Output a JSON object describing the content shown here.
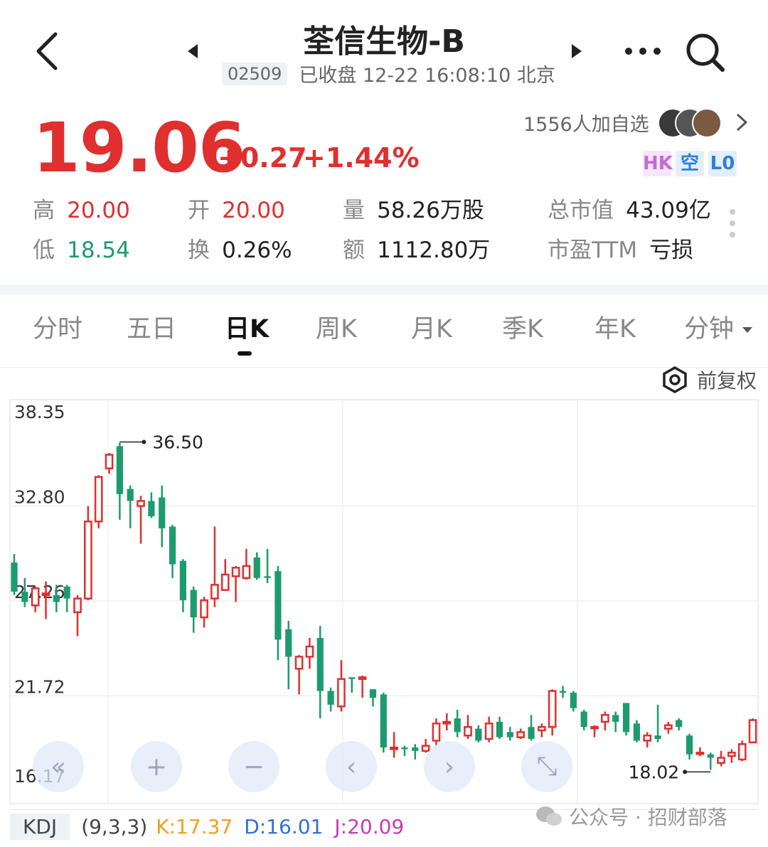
{
  "header": {
    "title": "荃信生物-B",
    "code": "02509",
    "status": "已收盘 12-22 16:08:10 北京"
  },
  "quote": {
    "price": "19.06",
    "change": "+0.27",
    "change_pct": "+1.44%",
    "watchers": "1556人加自选",
    "badges": [
      "HK",
      "空",
      "L0"
    ]
  },
  "stats": [
    {
      "label": "高",
      "value": "20.00",
      "color": "#e02f2f"
    },
    {
      "label": "开",
      "value": "20.00",
      "color": "#e02f2f"
    },
    {
      "label": "量",
      "value": "58.26万股",
      "color": "#222222"
    },
    {
      "label": "总市值",
      "value": "43.09亿",
      "color": "#222222"
    },
    {
      "label": "低",
      "value": "18.54",
      "color": "#1e9b6e"
    },
    {
      "label": "换",
      "value": "0.26%",
      "color": "#222222"
    },
    {
      "label": "额",
      "value": "1112.80万",
      "color": "#222222"
    },
    {
      "label": "市盈TTM",
      "value": "亏损",
      "color": "#222222"
    }
  ],
  "tabs": [
    "分时",
    "五日",
    "日K",
    "周K",
    "月K",
    "季K",
    "年K",
    "分钟"
  ],
  "active_tab": "日K",
  "adjust_label": "前复权",
  "colors": {
    "up": "#e02f2f",
    "down": "#1e9b6e",
    "accent_blue": "#2f6fe0"
  },
  "chart_data": {
    "type": "candlestick",
    "y_ticks": [
      "38.35",
      "32.80",
      "27.26",
      "21.72",
      "16.17"
    ],
    "ylim": [
      16.17,
      38.35
    ],
    "high_marker": "36.50",
    "low_marker": "18.02",
    "candles": [
      [
        29.5,
        27.8,
        30.0,
        27.6
      ],
      [
        27.8,
        27.2,
        28.6,
        26.9
      ],
      [
        27.0,
        28.0,
        28.1,
        26.6
      ],
      [
        27.6,
        27.7,
        28.4,
        26.2
      ],
      [
        27.6,
        27.2,
        28.2,
        26.6
      ],
      [
        28.1,
        27.4,
        28.2,
        26.6
      ],
      [
        26.6,
        27.4,
        27.6,
        25.2
      ],
      [
        27.4,
        31.9,
        32.8,
        27.3
      ],
      [
        31.9,
        34.5,
        34.6,
        31.5
      ],
      [
        35.0,
        35.8,
        35.9,
        34.7
      ],
      [
        36.3,
        33.5,
        36.5,
        32.0
      ],
      [
        33.8,
        33.1,
        34.0,
        31.5
      ],
      [
        32.8,
        33.1,
        33.4,
        30.6
      ],
      [
        33.1,
        32.2,
        33.6,
        32.1
      ],
      [
        33.3,
        31.5,
        34.0,
        30.4
      ],
      [
        31.6,
        29.4,
        31.7,
        28.6
      ],
      [
        29.6,
        27.3,
        29.7,
        26.6
      ],
      [
        27.9,
        26.3,
        28.1,
        25.4
      ],
      [
        26.3,
        27.3,
        27.5,
        25.7
      ],
      [
        27.4,
        28.2,
        31.6,
        26.9
      ],
      [
        27.9,
        28.8,
        29.7,
        28.1
      ],
      [
        28.7,
        29.2,
        29.3,
        27.2
      ],
      [
        28.6,
        29.3,
        30.3,
        28.5
      ],
      [
        29.8,
        28.6,
        30.1,
        28.5
      ],
      [
        28.7,
        28.6,
        30.3,
        28.3
      ],
      [
        29.0,
        25.0,
        29.3,
        23.8
      ],
      [
        25.6,
        24.0,
        26.1,
        22.1
      ],
      [
        23.3,
        24.0,
        24.1,
        21.8
      ],
      [
        24.0,
        24.6,
        25.1,
        23.3
      ],
      [
        25.1,
        22.0,
        25.8,
        20.4
      ],
      [
        22.0,
        21.2,
        22.2,
        20.8
      ],
      [
        21.1,
        22.7,
        23.8,
        20.8
      ],
      [
        22.8,
        22.7,
        22.8,
        21.9
      ],
      [
        22.7,
        22.8,
        22.9,
        21.6
      ],
      [
        22.1,
        21.6,
        22.1,
        21.1
      ],
      [
        21.8,
        18.7,
        21.9,
        18.4
      ],
      [
        18.6,
        18.7,
        19.6,
        18.1
      ],
      [
        18.7,
        18.6,
        18.8,
        18.2
      ],
      [
        18.7,
        18.5,
        18.9,
        18.0
      ],
      [
        18.5,
        18.8,
        19.2,
        18.4
      ],
      [
        19.1,
        20.1,
        20.4,
        18.8
      ],
      [
        20.1,
        20.2,
        20.7,
        19.7
      ],
      [
        20.4,
        19.6,
        20.9,
        19.3
      ],
      [
        19.4,
        19.9,
        20.6,
        19.2
      ],
      [
        19.8,
        19.1,
        20.0,
        19.0
      ],
      [
        19.2,
        20.1,
        20.5,
        19.0
      ],
      [
        20.2,
        19.3,
        20.5,
        19.2
      ],
      [
        19.6,
        19.3,
        19.9,
        19.1
      ],
      [
        19.3,
        19.6,
        19.8,
        19.2
      ],
      [
        19.9,
        19.2,
        20.6,
        19.1
      ],
      [
        19.7,
        19.9,
        20.1,
        19.3
      ],
      [
        19.9,
        22.0,
        22.1,
        19.4
      ],
      [
        22.0,
        21.9,
        22.3,
        21.6
      ],
      [
        21.9,
        21.0,
        22.0,
        20.8
      ],
      [
        20.8,
        19.9,
        20.9,
        19.7
      ],
      [
        19.9,
        19.9,
        20.0,
        19.3
      ],
      [
        20.2,
        20.6,
        20.8,
        19.7
      ],
      [
        20.6,
        20.2,
        20.8,
        19.6
      ],
      [
        21.3,
        19.6,
        21.3,
        19.4
      ],
      [
        20.1,
        19.1,
        20.3,
        19.0
      ],
      [
        19.1,
        19.4,
        19.6,
        18.7
      ],
      [
        19.4,
        19.2,
        21.2,
        19.0
      ],
      [
        19.8,
        20.0,
        20.2,
        19.5
      ],
      [
        20.3,
        19.9,
        20.4,
        19.7
      ],
      [
        19.4,
        18.3,
        19.5,
        18.0
      ],
      [
        18.4,
        18.4,
        18.7,
        18.2
      ],
      [
        18.3,
        18.1,
        18.4,
        17.4
      ],
      [
        17.8,
        18.1,
        18.5,
        17.6
      ],
      [
        18.2,
        18.4,
        18.6,
        17.8
      ],
      [
        18.0,
        18.9,
        19.1,
        17.9
      ],
      [
        19.0,
        20.3,
        20.4,
        19.0
      ]
    ]
  },
  "chart_controls": [
    "«",
    "+",
    "−",
    "‹",
    "›",
    "⤡"
  ],
  "indicator": {
    "name": "KDJ",
    "params": "(9,3,3)",
    "k": "K:17.37",
    "d": "D:16.01",
    "j": "J:20.09"
  },
  "watermark": "公众号 · 招财部落"
}
